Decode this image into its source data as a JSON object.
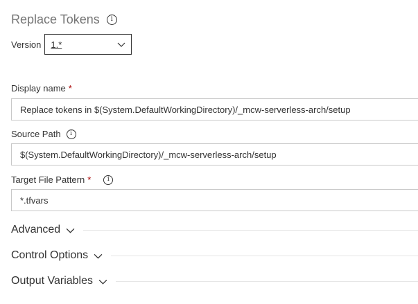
{
  "task": {
    "title": "Replace Tokens"
  },
  "version": {
    "label": "Version",
    "value": "1.*"
  },
  "fields": {
    "display_name": {
      "label": "Display name",
      "required_mark": "*",
      "value": "Replace tokens in $(System.DefaultWorkingDirectory)/_mcw-serverless-arch/setup"
    },
    "source_path": {
      "label": "Source Path",
      "value": "$(System.DefaultWorkingDirectory)/_mcw-serverless-arch/setup"
    },
    "target_file_pattern": {
      "label": "Target File Pattern",
      "required_mark": "*",
      "value": "*.tfvars"
    }
  },
  "sections": {
    "advanced": "Advanced",
    "control_options": "Control Options",
    "output_variables": "Output Variables"
  },
  "icons": {
    "info": "info-icon",
    "chevron": "chevron-down-icon"
  },
  "colors": {
    "required": "#a80000",
    "title": "#767676",
    "input_border": "#c8c8c8"
  }
}
